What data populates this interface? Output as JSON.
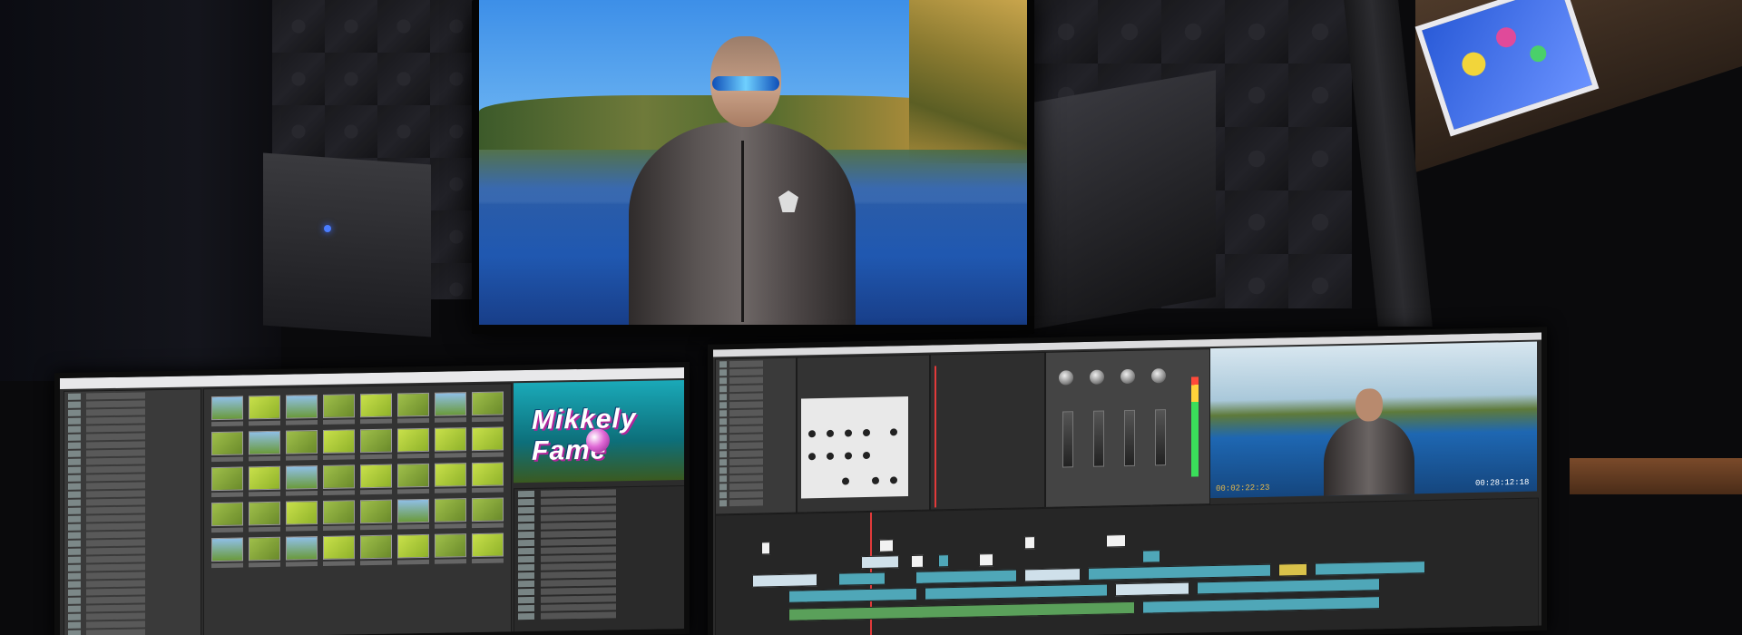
{
  "scene": {
    "description_tags": [
      "video-editing-studio",
      "three-monitors",
      "acoustic-foam-wall"
    ]
  },
  "left_monitor": {
    "logo_text": "Mikkely Fame",
    "thumbnail_count": 40
  },
  "right_monitor": {
    "timecode_left": "00:02:22:23",
    "timecode_right": "00:28:12:18"
  },
  "colors": {
    "accent_timecode": "#e6b84a",
    "playhead": "#e23a3a",
    "clip_aqua": "#4fa7b8",
    "speaker_led": "#4a7dff"
  }
}
